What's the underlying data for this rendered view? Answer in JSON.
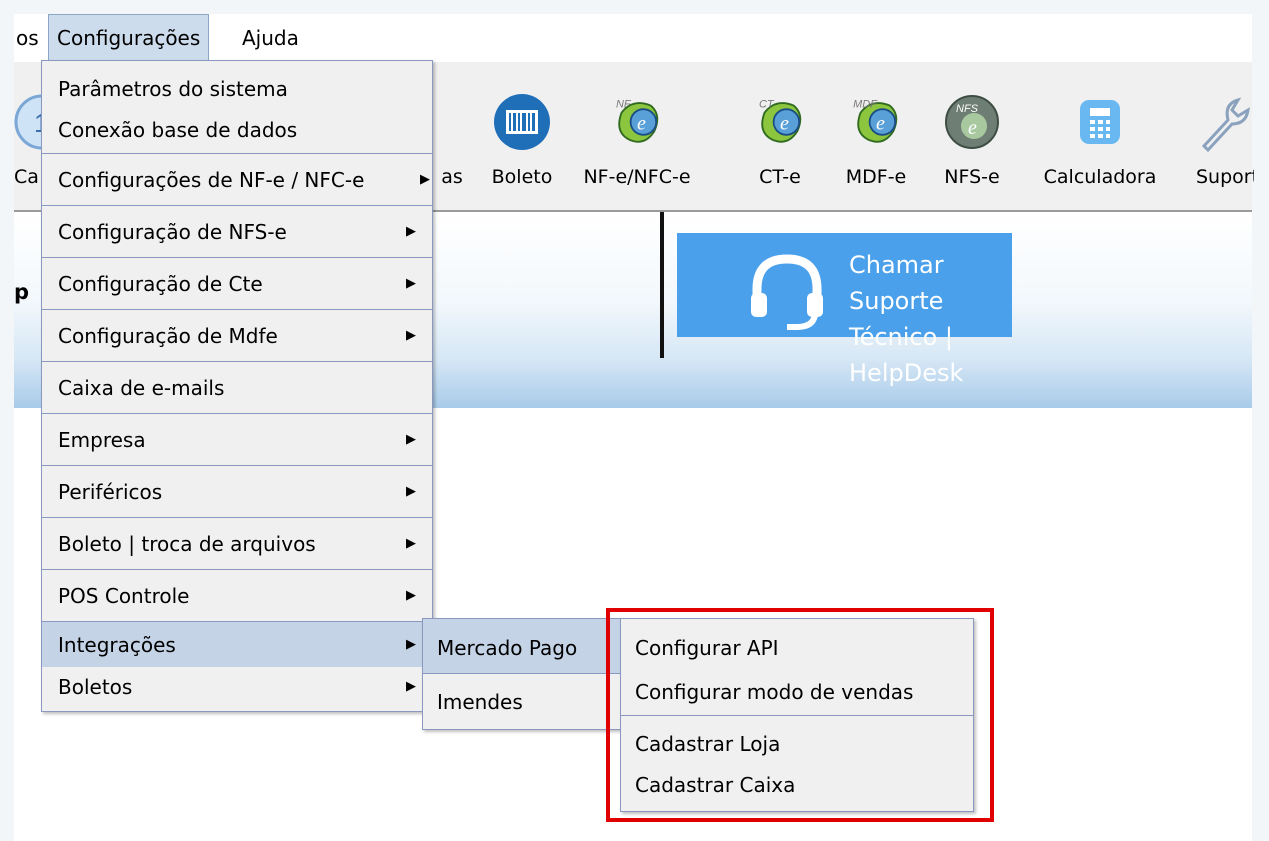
{
  "menubar": {
    "items": [
      {
        "label": "os"
      },
      {
        "label": "Configurações"
      },
      {
        "label": "Ajuda"
      }
    ]
  },
  "toolbar": {
    "cut_left_label": "Ca",
    "cut_left2_label": "as",
    "items": [
      {
        "label": "Boleto",
        "icon": "barcode-icon"
      },
      {
        "label": "NF-e/NFC-e",
        "icon": "nfe-icon"
      },
      {
        "label": "CT-e",
        "icon": "cte-icon"
      },
      {
        "label": "MDF-e",
        "icon": "mdfe-icon"
      },
      {
        "label": "NFS-e",
        "icon": "nfse-icon"
      },
      {
        "label": "Calculadora",
        "icon": "calculator-icon"
      },
      {
        "label": "Suport",
        "icon": "wrench-icon"
      }
    ]
  },
  "banner": {
    "cut_label": "p",
    "support_line1": "Chamar Suporte",
    "support_line2": "Técnico | HelpDesk"
  },
  "config_menu": {
    "items": [
      {
        "label": "Parâmetros do sistema"
      },
      {
        "label": "Conexão base de dados"
      },
      {
        "label": "Configurações de NF-e / NFC-e"
      },
      {
        "label": "Configuração de NFS-e"
      },
      {
        "label": "Configuração de Cte"
      },
      {
        "label": "Configuração de Mdfe"
      },
      {
        "label": "Caixa de e-mails"
      },
      {
        "label": "Empresa"
      },
      {
        "label": "Periféricos"
      },
      {
        "label": "Boleto | troca de arquivos"
      },
      {
        "label": "POS Controle"
      },
      {
        "label": "Integrações"
      },
      {
        "label": "Boletos"
      }
    ]
  },
  "integrations_menu": {
    "items": [
      {
        "label": "Mercado Pago"
      },
      {
        "label": "Imendes"
      }
    ]
  },
  "mercado_pago_menu": {
    "items": [
      {
        "label": "Configurar API"
      },
      {
        "label": "Configurar modo de vendas"
      },
      {
        "label": "Cadastrar Loja"
      },
      {
        "label": "Cadastrar Caixa"
      }
    ]
  },
  "colors": {
    "accent": "#4aa0ea",
    "highlight_box": "#e00000",
    "menu_highlight": "#c5d3e6"
  }
}
